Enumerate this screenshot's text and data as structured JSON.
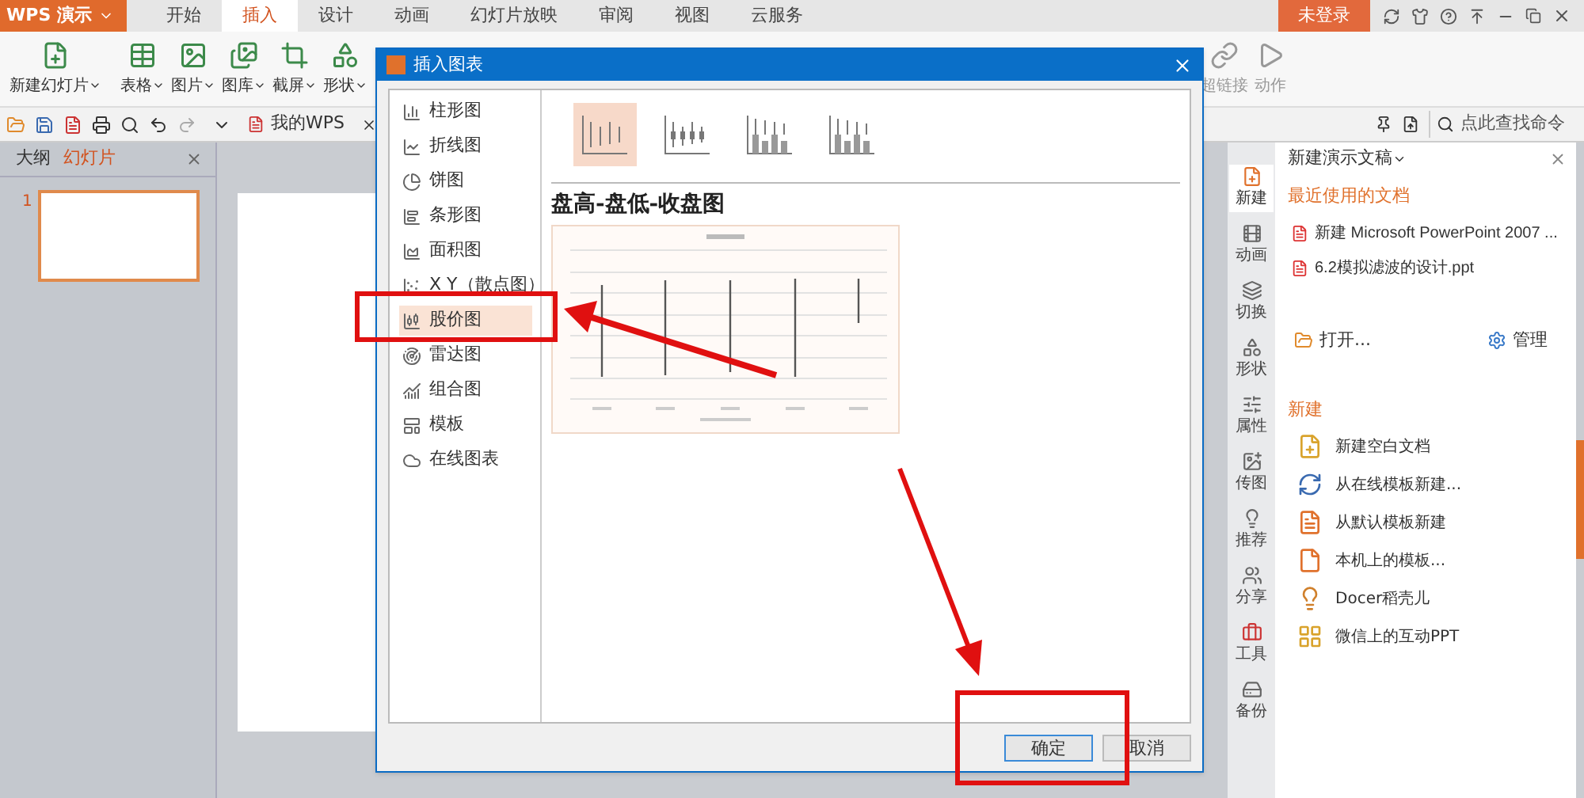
{
  "app": {
    "logo": "WPS 演示",
    "login": "未登录"
  },
  "menu_tabs": [
    {
      "label": "开始",
      "selected": false
    },
    {
      "label": "插入",
      "selected": true
    },
    {
      "label": "设计",
      "selected": false
    },
    {
      "label": "动画",
      "selected": false
    },
    {
      "label": "幻灯片放映",
      "selected": false
    },
    {
      "label": "审阅",
      "selected": false
    },
    {
      "label": "视图",
      "selected": false
    },
    {
      "label": "云服务",
      "selected": false
    }
  ],
  "ribbon_left": [
    {
      "label": "新建幻灯片",
      "disabled": false
    },
    {
      "label": "表格",
      "disabled": false
    },
    {
      "label": "图片",
      "disabled": false
    },
    {
      "label": "图库",
      "disabled": false
    },
    {
      "label": "截屏",
      "disabled": false
    },
    {
      "label": "形状",
      "disabled": false
    }
  ],
  "ribbon_right": [
    {
      "label": "超链接",
      "disabled": true
    },
    {
      "label": "动作",
      "disabled": true
    }
  ],
  "quick_bar": {
    "doc_tab": "我的WPS",
    "search_placeholder": "点此查找命令"
  },
  "left_panel": {
    "tabs": [
      {
        "label": "大纲",
        "selected": false
      },
      {
        "label": "幻灯片",
        "selected": true
      }
    ],
    "slides": [
      {
        "number": "1",
        "selected": true
      }
    ]
  },
  "dialog": {
    "title": "插入图表",
    "chart_types": [
      {
        "label": "柱形图",
        "selected": false
      },
      {
        "label": "折线图",
        "selected": false
      },
      {
        "label": "饼图",
        "selected": false
      },
      {
        "label": "条形图",
        "selected": false
      },
      {
        "label": "面积图",
        "selected": false
      },
      {
        "label": "X Y（散点图）",
        "selected": false
      },
      {
        "label": "股价图",
        "selected": true
      },
      {
        "label": "雷达图",
        "selected": false
      },
      {
        "label": "组合图",
        "selected": false
      },
      {
        "label": "模板",
        "selected": false
      },
      {
        "label": "在线图表",
        "selected": false
      }
    ],
    "subtypes": [
      {
        "selected": true
      },
      {
        "selected": false
      },
      {
        "selected": false
      },
      {
        "selected": false
      }
    ],
    "subtype_title": "盘高-盘低-收盘图",
    "buttons": [
      {
        "label": "确定",
        "default": true
      },
      {
        "label": "取消",
        "default": false
      }
    ]
  },
  "side_tabs": [
    {
      "label": "新建",
      "selected": true
    },
    {
      "label": "动画",
      "selected": false
    },
    {
      "label": "切换",
      "selected": false
    },
    {
      "label": "形状",
      "selected": false
    },
    {
      "label": "属性",
      "selected": false
    },
    {
      "label": "传图",
      "selected": false
    },
    {
      "label": "推荐",
      "selected": false
    },
    {
      "label": "分享",
      "selected": false
    },
    {
      "label": "工具",
      "selected": false
    },
    {
      "label": "备份",
      "selected": false
    }
  ],
  "task_pane": {
    "title": "新建演示文稿",
    "recent_heading": "最近使用的文档",
    "recent": [
      "新建 Microsoft PowerPoint 2007 ...",
      "6.2模拟滤波的设计.ppt"
    ],
    "open": "打开...",
    "manage": "管理",
    "new_heading": "新建",
    "new_items": [
      "新建空白文档",
      "从在线模板新建...",
      "从默认模板新建",
      "本机上的模板...",
      "Docer稻壳儿",
      "微信上的互动PPT"
    ]
  }
}
